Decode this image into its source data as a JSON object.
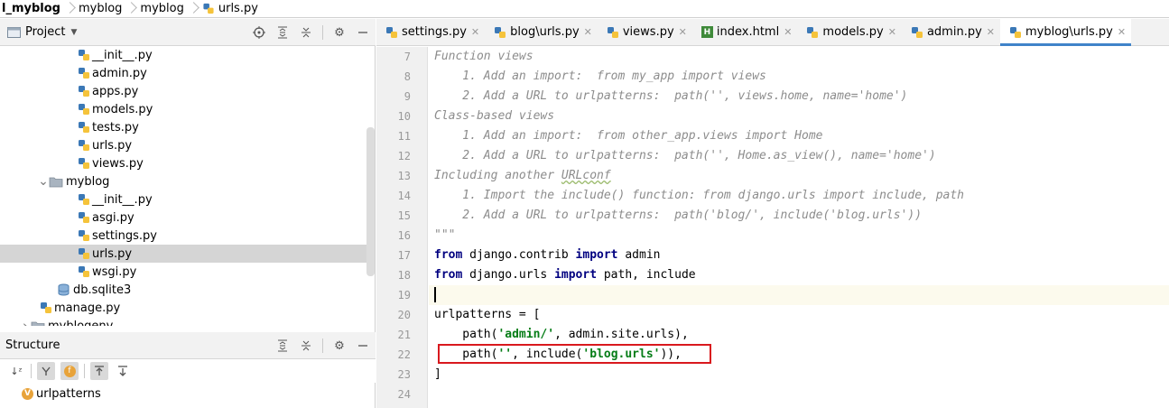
{
  "breadcrumb": {
    "items": [
      "l_myblog",
      "myblog",
      "myblog",
      "urls.py"
    ]
  },
  "project_panel": {
    "title": "Project",
    "tree": [
      {
        "label": "__init__.py",
        "type": "py",
        "depth": 4
      },
      {
        "label": "admin.py",
        "type": "py",
        "depth": 4
      },
      {
        "label": "apps.py",
        "type": "py",
        "depth": 4
      },
      {
        "label": "models.py",
        "type": "py",
        "depth": 4
      },
      {
        "label": "tests.py",
        "type": "py",
        "depth": 4
      },
      {
        "label": "urls.py",
        "type": "py",
        "depth": 4
      },
      {
        "label": "views.py",
        "type": "py",
        "depth": 4
      },
      {
        "label": "myblog",
        "type": "folder",
        "depth": 3,
        "expanded": true
      },
      {
        "label": "__init__.py",
        "type": "py",
        "depth": 4
      },
      {
        "label": "asgi.py",
        "type": "py",
        "depth": 4
      },
      {
        "label": "settings.py",
        "type": "py",
        "depth": 4
      },
      {
        "label": "urls.py",
        "type": "py",
        "depth": 4,
        "selected": true
      },
      {
        "label": "wsgi.py",
        "type": "py",
        "depth": 4
      },
      {
        "label": "db.sqlite3",
        "type": "db",
        "depth": 3
      },
      {
        "label": "manage.py",
        "type": "py",
        "depth": 3
      },
      {
        "label": "myblogenv",
        "type": "folder",
        "depth": 1,
        "expanded": false
      }
    ]
  },
  "structure_panel": {
    "title": "Structure",
    "item": "urlpatterns",
    "item_badge": "V"
  },
  "editor": {
    "tabs": [
      {
        "label": "settings.py",
        "type": "py"
      },
      {
        "label": "blog\\urls.py",
        "type": "py"
      },
      {
        "label": "views.py",
        "type": "py"
      },
      {
        "label": "index.html",
        "type": "html"
      },
      {
        "label": "models.py",
        "type": "py"
      },
      {
        "label": "admin.py",
        "type": "py"
      },
      {
        "label": "myblog\\urls.py",
        "type": "py",
        "active": true
      }
    ],
    "line_numbers": [
      "7",
      "8",
      "9",
      "10",
      "11",
      "12",
      "13",
      "14",
      "15",
      "16",
      "17",
      "18",
      "19",
      "20",
      "21",
      "22",
      "23",
      "24"
    ],
    "code": {
      "l7": "Function views",
      "l8": "    1. Add an import:  from my_app import views",
      "l9": "    2. Add a URL to urlpatterns:  path('', views.home, name='home')",
      "l10": "Class-based views",
      "l11": "    1. Add an import:  from other_app.views import Home",
      "l12": "    2. Add a URL to urlpatterns:  path('', Home.as_view(), name='home')",
      "l13_a": "Including another ",
      "l13_b": "URLconf",
      "l14": "    1. Import the include() function: from django.urls import include, path",
      "l15": "    2. Add a URL to urlpatterns:  path('blog/', include('blog.urls'))",
      "l16": "\"\"\"",
      "l17_kw1": "from",
      "l17_mid": " django.contrib ",
      "l17_kw2": "import",
      "l17_end": " admin",
      "l18_kw1": "from",
      "l18_mid": " django.urls ",
      "l18_kw2": "import",
      "l18_end": " path, include",
      "l20": "urlpatterns = [",
      "l21_a": "    path(",
      "l21_s": "'admin/'",
      "l21_b": ", admin.site.urls),",
      "l22_a": "    path(",
      "l22_s1": "''",
      "l22_b": ", include(",
      "l22_s2": "'blog.urls'",
      "l22_c": ")),",
      "l23": "]"
    },
    "highlight_color": "#d9191e"
  }
}
